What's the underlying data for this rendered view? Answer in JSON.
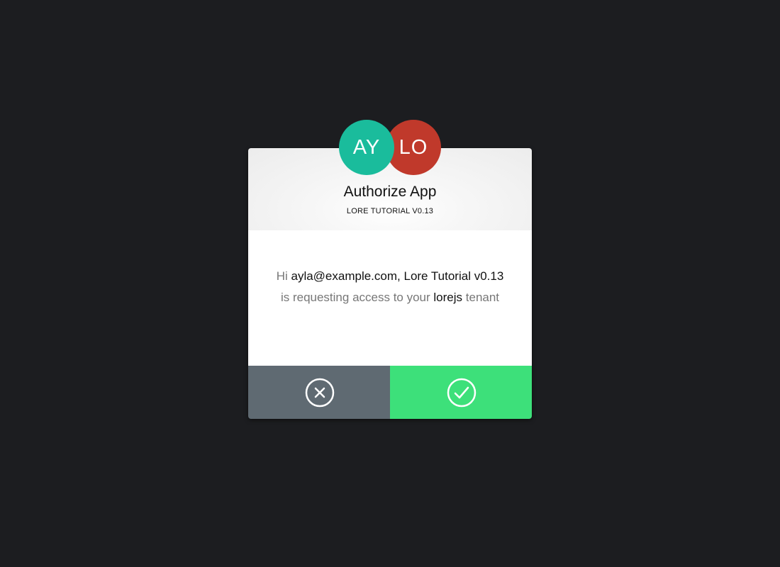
{
  "dialog": {
    "title": "Authorize App",
    "subtitle": "LORE TUTORIAL V0.13",
    "avatars": [
      {
        "initials": "AY",
        "color": "#1abc9c"
      },
      {
        "initials": "LO",
        "color": "#c0392b"
      }
    ],
    "message": {
      "greeting": "Hi",
      "user": "ayla@example.com,",
      "app": "Lore Tutorial v0.13",
      "middle": "is requesting access to your",
      "tenant": "lorejs",
      "end": "tenant"
    },
    "actions": {
      "deny_icon": "close-circle-icon",
      "allow_icon": "check-circle-icon",
      "deny_color": "#5f6a72",
      "allow_color": "#3de07a"
    }
  },
  "colors": {
    "background": "#1c1d20"
  }
}
